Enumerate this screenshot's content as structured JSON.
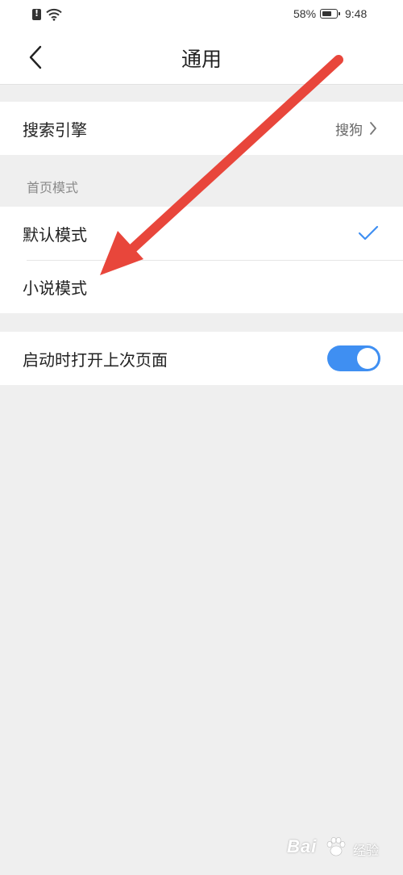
{
  "status_bar": {
    "battery": "58%",
    "time": "9:48"
  },
  "header": {
    "title": "通用"
  },
  "search_engine": {
    "label": "搜索引擎",
    "value": "搜狗"
  },
  "homepage_mode": {
    "section_title": "首页模式",
    "options": [
      {
        "label": "默认模式",
        "selected": true
      },
      {
        "label": "小说模式",
        "selected": false
      }
    ]
  },
  "startup": {
    "label": "启动时打开上次页面",
    "enabled": true
  },
  "colors": {
    "accent": "#3f8ff2",
    "annotation_arrow": "#e8463b",
    "background": "#efefef"
  },
  "watermark": {
    "brand": "Bai",
    "suffix": "经验"
  }
}
